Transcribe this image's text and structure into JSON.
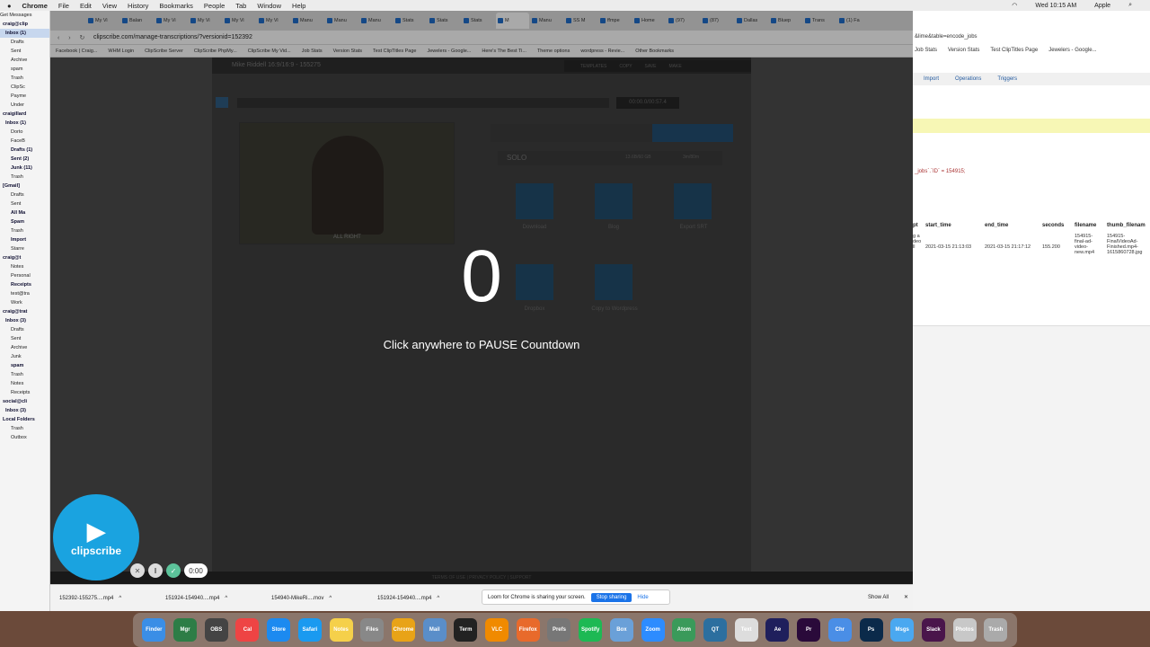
{
  "menubar": {
    "items": [
      "Chrome",
      "File",
      "Edit",
      "View",
      "History",
      "Bookmarks",
      "People",
      "Tab",
      "Window",
      "Help"
    ],
    "clock": "Wed 10:15 AM",
    "user": "Apple"
  },
  "mail": {
    "get_messages": "Get Messages",
    "rows": [
      "craig@clip",
      "Inbox (1)",
      "Drafts",
      "Sent",
      "Archive",
      "spam",
      "Trash",
      "ClipSc",
      "Payme",
      "Under",
      "craigillard",
      "Inbox (1)",
      "Dorto",
      "FaceB",
      "Drafts (1)",
      "Sent (2)",
      "Junk (11)",
      "Trash",
      "[Gmail]",
      "Drafts",
      "Sent",
      "All Ma",
      "Spam",
      "Trash",
      "Import",
      "Starre",
      "craig@t",
      "Notes",
      "Personal",
      "Receipts",
      "test@tra",
      "Work",
      "craig@trat",
      "Inbox (3)",
      "Drafts",
      "Sent",
      "Archive",
      "Junk",
      "spam",
      "Trash",
      "Notes",
      "Receipts",
      "social@cli",
      "Inbox (3)",
      "Local Folders",
      "Trash",
      "Outbox"
    ]
  },
  "tabs": [
    "My Vi",
    "Balan",
    "My Vi",
    "My Vi",
    "My Vi",
    "My Vi",
    "Manu",
    "Manu",
    "Manu",
    "Stats",
    "Stats",
    "Stats",
    "M",
    "Manu",
    "SS M",
    "ffmpe",
    "Home",
    "(97)",
    "(87)",
    "Dallas",
    "Bluep",
    "Trans",
    "(1) Fa"
  ],
  "address": {
    "url": "clipscribe.com/manage-transcriptions/?versionid=152392"
  },
  "bookmarks": [
    "Facebook | Craig...",
    "WHM Login",
    "ClipScribe Server",
    "ClipScribe PhpMy...",
    "ClipScribe My Vid...",
    "Job Stats",
    "Version Stats",
    "Test ClipTitles Page",
    "Jewelers - Google...",
    "Here's The Best Ti...",
    "Theme options",
    "wordpress - Revie...",
    "Other Bookmarks"
  ],
  "editor": {
    "title": "Mike Riddell 16:9/16:9 - 155275",
    "toolbar": [
      "TEMPLATES",
      "COPY",
      "SAVE",
      "MAKE"
    ],
    "time": "00:00.0/00:57.4",
    "plan": "SOLO",
    "storage": "13.6B/60 GB",
    "time_badge": "3m/80m",
    "video_caption": "ALL RIGHT",
    "exports": [
      "Download",
      "Blog",
      "Export SRT",
      "Dropbox",
      "Copy to Wordpress"
    ]
  },
  "footer": {
    "links": "TERMS OF USE | PRIVACY POLICY | SUPPORT"
  },
  "overlay": {
    "countdown": "0",
    "pause_message": "Click anywhere to PAUSE Countdown"
  },
  "recorder": {
    "brand": "clipscribe",
    "timer": "0:00"
  },
  "downloads": {
    "items": [
      "152392-155275....mp4",
      "151924-154940....mp4",
      "154940-MikeRi....mov",
      "151924-154940....mp4"
    ],
    "show_all": "Show All"
  },
  "loom": {
    "message": "Loom for Chrome is sharing your screen.",
    "stop": "Stop sharing",
    "hide": "Hide"
  },
  "rightpanel": {
    "url": "&lime&table=encode_jobs",
    "bookmarks": [
      "Job Stats",
      "Version Stats",
      "Test ClipTitles Page",
      "Jewelers - Google..."
    ],
    "tabs": [
      "Import",
      "Operations",
      "Triggers"
    ],
    "query": "_jobs`.`ID` = 154915;",
    "columns": [
      "pt",
      "start_time",
      "end_time",
      "seconds",
      "filename",
      "thumb_filenam"
    ],
    "row": {
      "pt": "g a\ndeo\nll",
      "start_time": "2021-03-15 21:13:03",
      "end_time": "2021-03-15 21:17:12",
      "seconds": "155.200",
      "filename": "154915-\nfinal-ad-\nvideo-\nnew.mp4",
      "thumb": "154915-\nFinalVideoAd-\nFinished.mp4-\n1615860728.jpg"
    }
  },
  "dock": [
    "Finder",
    "Mgr",
    "OBS",
    "Cal",
    "Store",
    "Safari",
    "Notes",
    "Files",
    "Chrome",
    "Mail",
    "Term",
    "VLC",
    "Firefox",
    "Prefs",
    "Spotify",
    "Box",
    "Zoom",
    "Atom",
    "QT",
    "Text",
    "Ae",
    "Pr",
    "Chr",
    "Ps",
    "Msgs",
    "Slack",
    "Photos",
    "Trash"
  ]
}
